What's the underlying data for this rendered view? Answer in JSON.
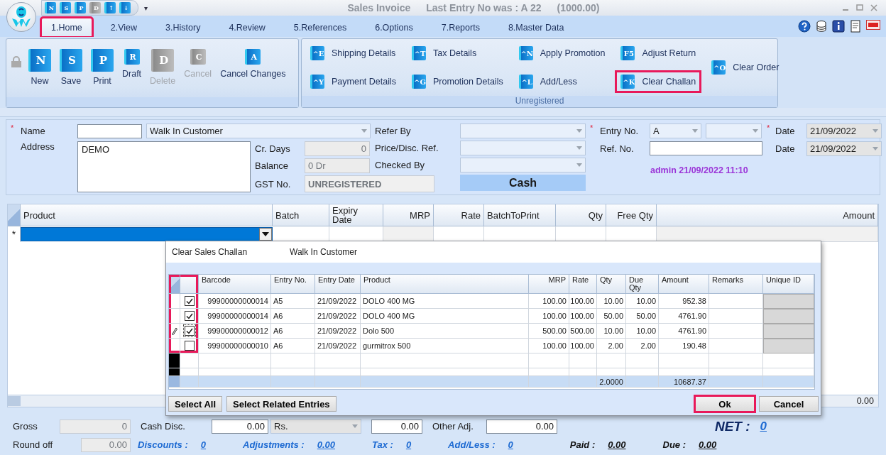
{
  "window": {
    "title": "Sales Invoice",
    "subtitle": "Last Entry No was : A 22",
    "subtitle_amount": "(1000.00)"
  },
  "quick_access": [
    {
      "key": "N",
      "disabled": false
    },
    {
      "key": "S",
      "disabled": false
    },
    {
      "key": "P",
      "disabled": false
    },
    {
      "key": "D",
      "disabled": true
    },
    {
      "key": "↑",
      "disabled": false
    },
    {
      "key": "↓",
      "disabled": false
    }
  ],
  "quick_access_menu": "▾",
  "tabs": [
    {
      "label": "1.Home",
      "selected": true,
      "highlighted": true
    },
    {
      "label": "2.View",
      "selected": false,
      "highlighted": false
    },
    {
      "label": "3.History",
      "selected": false,
      "highlighted": false
    },
    {
      "label": "4.Review",
      "selected": false,
      "highlighted": false
    },
    {
      "label": "5.References",
      "selected": false,
      "highlighted": false
    },
    {
      "label": "6.Options",
      "selected": false,
      "highlighted": false
    },
    {
      "label": "7.Reports",
      "selected": false,
      "highlighted": false
    },
    {
      "label": "8.Master Data",
      "selected": false,
      "highlighted": false
    }
  ],
  "ribbon_main": [
    {
      "label": "New",
      "key": "N",
      "kind": "large",
      "disabled": false
    },
    {
      "label": "Save",
      "key": "S",
      "kind": "large",
      "disabled": false
    },
    {
      "label": "Print",
      "key": "P",
      "kind": "large",
      "disabled": false
    },
    {
      "label": "Draft",
      "key": "R",
      "kind": "small",
      "disabled": false
    },
    {
      "label": "Delete",
      "key": "D",
      "kind": "large",
      "disabled": true
    },
    {
      "label": "Cancel",
      "key": "C",
      "kind": "small",
      "disabled": true
    },
    {
      "label": "Cancel Changes",
      "key": "A",
      "kind": "small",
      "disabled": false
    }
  ],
  "ribbon_details": {
    "caption": "Unregistered",
    "columns": [
      [
        {
          "label": "Shipping Details",
          "key": "^E",
          "highlighted": false
        },
        {
          "label": "Payment Details",
          "key": "^Y",
          "highlighted": false
        }
      ],
      [
        {
          "label": "Tax Details",
          "key": "^T",
          "highlighted": false
        },
        {
          "label": "Promotion Details",
          "key": "^G",
          "highlighted": false
        }
      ],
      [
        {
          "label": "Apply Promotion",
          "key": "^N",
          "highlighted": false
        },
        {
          "label": "Add/Less",
          "key": "^L",
          "highlighted": false
        }
      ],
      [
        {
          "label": "Adjust Return",
          "key": "F5",
          "highlighted": false
        },
        {
          "label": "Clear Challan",
          "key": "^K",
          "highlighted": true
        }
      ],
      [
        {
          "label": "Clear Order",
          "key": "^O",
          "highlighted": false
        }
      ]
    ]
  },
  "form": {
    "name": {
      "label": "Name",
      "required": true,
      "value": "Walk In Customer"
    },
    "address": {
      "label": "Address",
      "value": "DEMO"
    },
    "account": [
      {
        "label": "Cr. Days",
        "value": "0",
        "kind": "number"
      },
      {
        "label": "Balance",
        "value": "0 Dr",
        "kind": "text"
      },
      {
        "label": "GST No.",
        "value": "UNREGISTERED",
        "kind": "bold"
      }
    ],
    "references": [
      {
        "label": "Refer By"
      },
      {
        "label": "Price/Disc. Ref."
      },
      {
        "label": "Checked By"
      }
    ],
    "payment_mode": "Cash",
    "entry_no": {
      "label": "Entry No.",
      "required": true,
      "series": "A"
    },
    "ref_no": {
      "label": "Ref. No."
    },
    "dates": [
      {
        "label": "Date",
        "required": true,
        "value": "21/09/2022"
      },
      {
        "label": "Date",
        "required": false,
        "value": "21/09/2022"
      }
    ],
    "user_stamp": "admin 21/09/2022 11:10"
  },
  "items_grid": {
    "columns": [
      "Product",
      "Batch",
      "Expiry Date",
      "MRP",
      "Rate",
      "BatchToPrint",
      "Qty",
      "Free Qty",
      "Amount"
    ],
    "new_row_marker": "*",
    "total": "0.00"
  },
  "dialog": {
    "title": "Clear Sales Challan",
    "customer": "Walk In Customer",
    "checkbox_column_highlighted": true,
    "columns": [
      "Barcode",
      "Entry No.",
      "Entry Date",
      "Product",
      "MRP",
      "Rate",
      "Qty",
      "Due Qty",
      "Amount",
      "Remarks",
      "Unique ID"
    ],
    "rows": [
      {
        "checked": true,
        "editing": false,
        "cells": [
          "99900000000014",
          "A5",
          "21/09/2022",
          "DOLO 400 MG",
          "100.00",
          "100.00",
          "10.00",
          "10.00",
          "952.38"
        ]
      },
      {
        "checked": true,
        "editing": false,
        "cells": [
          "99900000000014",
          "A6",
          "21/09/2022",
          "DOLO 400 MG",
          "100.00",
          "100.00",
          "50.00",
          "50.00",
          "4761.90"
        ]
      },
      {
        "checked": true,
        "editing": true,
        "cells": [
          "99900000000012",
          "A6",
          "21/09/2022",
          "Dolo 500",
          "500.00",
          "500.00",
          "10.00",
          "10.00",
          "4761.90"
        ]
      },
      {
        "checked": false,
        "editing": false,
        "cells": [
          "99900000000010",
          "A6",
          "21/09/2022",
          "gurmitrox 500",
          "100.00",
          "100.00",
          "2.00",
          "2.00",
          "190.48"
        ]
      }
    ],
    "total_qty": "2.0000",
    "total_amount": "10687.37",
    "left_buttons": [
      {
        "label": "Select All",
        "highlighted": false
      },
      {
        "label": "Select Related Entries",
        "highlighted": false
      }
    ],
    "right_buttons": [
      {
        "label": "Ok",
        "highlighted": true
      },
      {
        "label": "Cancel",
        "highlighted": false
      }
    ]
  },
  "footer": {
    "gross": {
      "label": "Gross",
      "value": "0"
    },
    "cash_disc": {
      "label": "Cash Disc.",
      "value": "0.00",
      "unit": "Rs.",
      "amount": "0.00"
    },
    "other_adj": {
      "label": "Other Adj.",
      "value": "0.00"
    },
    "net": {
      "label": "NET :",
      "value": "0"
    },
    "round_off": {
      "label": "Round off",
      "value": "0.00"
    },
    "summary": [
      {
        "label": "Discounts :",
        "value": "0",
        "kind": "link"
      },
      {
        "label": "Adjustments :",
        "value": "0.00",
        "kind": "link"
      },
      {
        "label": "Tax :",
        "value": "0",
        "kind": "link"
      },
      {
        "label": "Add/Less :",
        "value": "0",
        "kind": "link"
      },
      {
        "label": "Paid :",
        "value": "0.00",
        "kind": "dark"
      },
      {
        "label": "Due :",
        "value": "0.00",
        "kind": "dark"
      }
    ]
  }
}
